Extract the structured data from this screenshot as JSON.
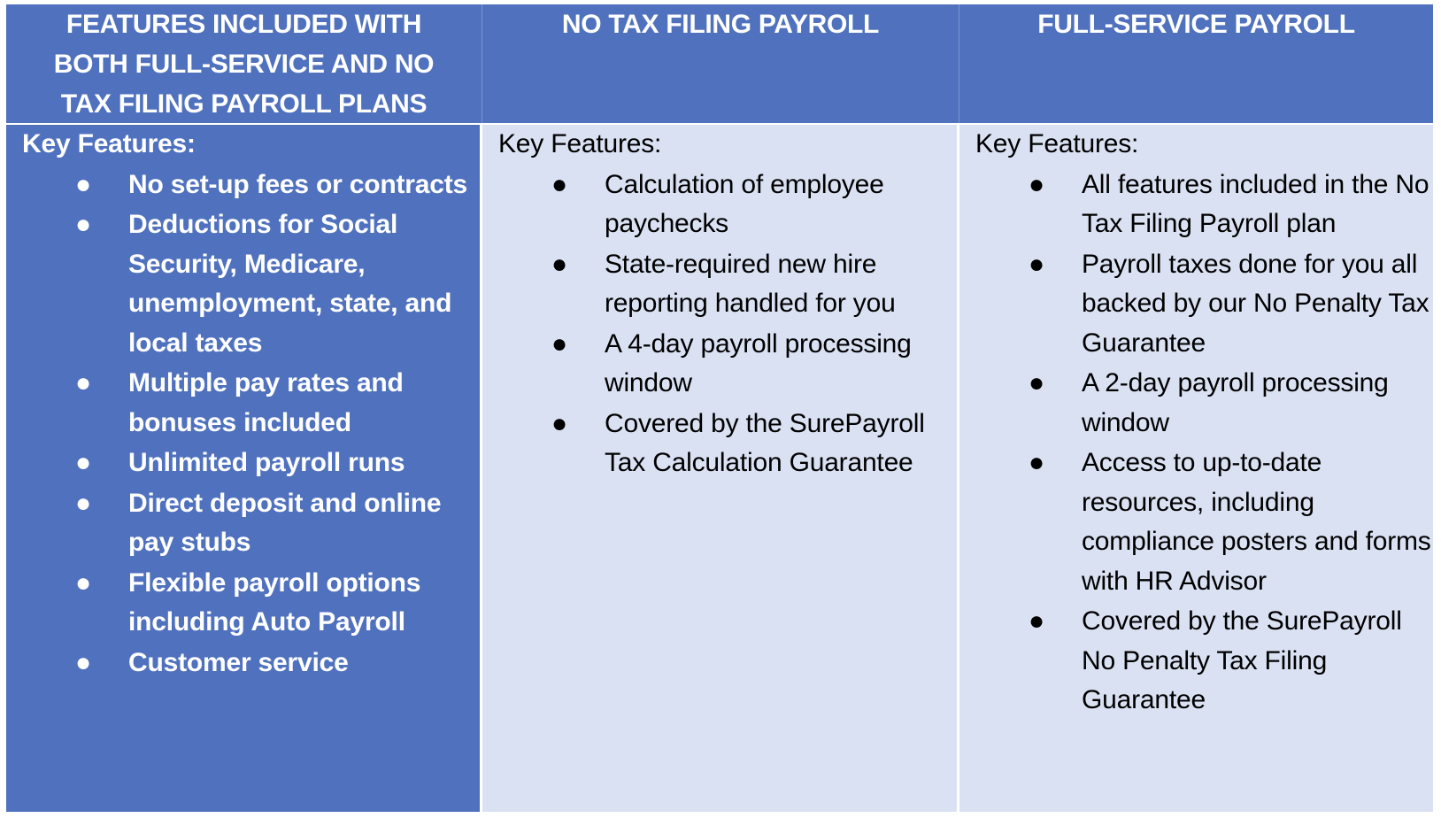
{
  "colors": {
    "header_bg": "#4f71be",
    "shared_column_bg": "#4f71be",
    "plan_column_bg": "#dae1f2",
    "header_text": "#ffffff",
    "body_text_dark": "#000000"
  },
  "table": {
    "headers": [
      "FEATURES INCLUDED WITH BOTH FULL-SERVICE AND NO TAX FILING PAYROLL PLANS",
      "NO TAX FILING PAYROLL",
      "FULL-SERVICE PAYROLL"
    ],
    "columns": [
      {
        "key_label": "Key Features:",
        "bullet_icon": "bullet-dot",
        "items": [
          "No set-up fees or contracts",
          "Deductions for Social Security, Medicare, unemployment, state, and local taxes",
          "Multiple pay rates and bonuses included",
          "Unlimited payroll runs",
          "Direct deposit and online pay stubs",
          "Flexible payroll options including Auto Payroll",
          "Customer service"
        ]
      },
      {
        "key_label": "Key Features:",
        "bullet_icon": "bullet-dot",
        "items": [
          "Calculation of employee paychecks",
          "State-required new hire reporting handled for you",
          "A 4-day payroll processing window",
          "Covered by the SurePayroll Tax Calculation Guarantee"
        ]
      },
      {
        "key_label": "Key Features:",
        "bullet_icon": "bullet-dot",
        "items": [
          "All features included in the No Tax Filing Payroll plan",
          "Payroll taxes done for you all backed by our No Penalty Tax Guarantee",
          "A 2-day payroll processing window",
          "Access to up-to-date resources, including compliance posters and forms with HR Advisor",
          "Covered by the SurePayroll No Penalty Tax Filing Guarantee"
        ]
      }
    ]
  }
}
